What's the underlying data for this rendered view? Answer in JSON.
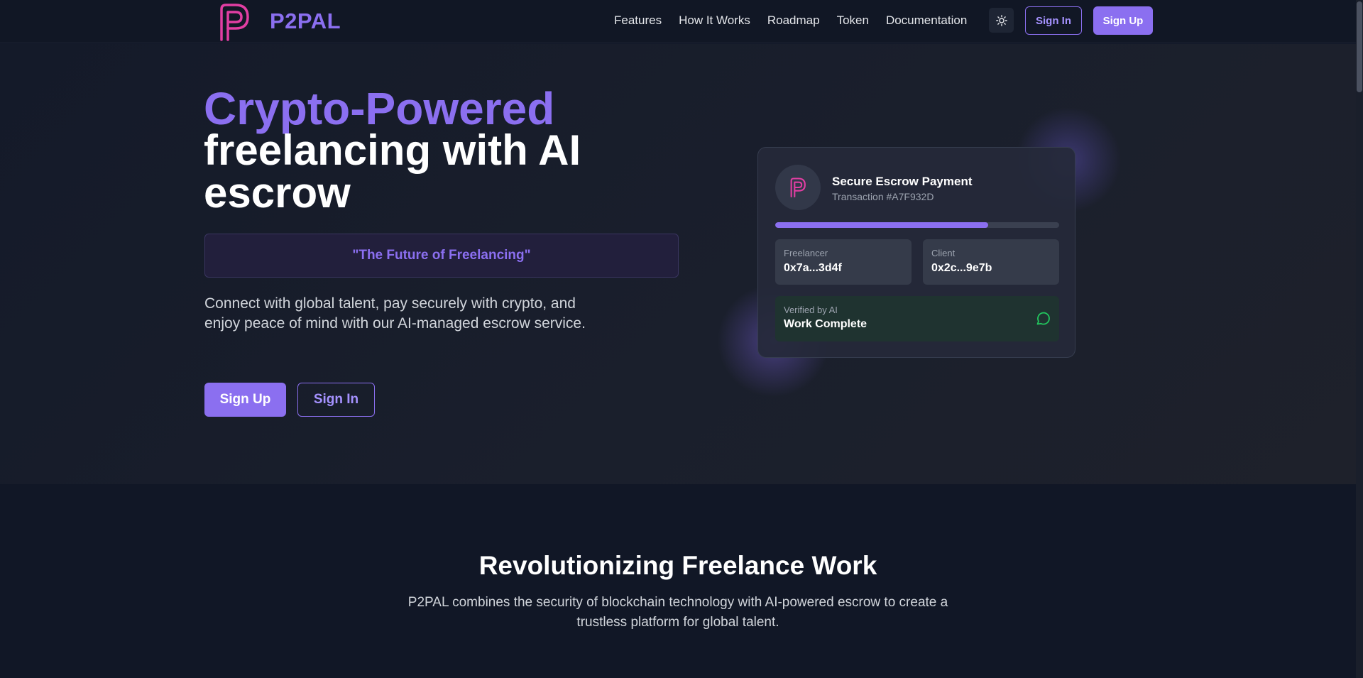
{
  "brand": {
    "name": "P2PAL"
  },
  "nav": {
    "links": [
      "Features",
      "How It Works",
      "Roadmap",
      "Token",
      "Documentation"
    ],
    "sign_in": "Sign In",
    "sign_up": "Sign Up",
    "theme_icon": "sun-icon"
  },
  "hero": {
    "title_accent": "Crypto-Powered",
    "title_line2": "freelancing with AI",
    "title_line3": "escrow",
    "tagline": "\"The Future of Freelancing\"",
    "description": "Connect with global talent, pay securely with crypto, and enjoy peace of mind with our AI-managed escrow service.",
    "sign_up": "Sign Up",
    "sign_in": "Sign In"
  },
  "card": {
    "title": "Secure Escrow Payment",
    "transaction": "Transaction #A7F932D",
    "progress": 0.75,
    "freelancer": {
      "label": "Freelancer",
      "value": "0x7a...3d4f"
    },
    "client": {
      "label": "Client",
      "value": "0x2c...9e7b"
    },
    "verify": {
      "label": "Verified by AI",
      "value": "Work Complete",
      "icon": "chat-bubble-icon"
    }
  },
  "section2": {
    "title": "Revolutionizing Freelance Work",
    "description": "P2PAL combines the security of blockchain technology with AI-powered escrow to create a trustless platform for global talent."
  },
  "colors": {
    "accent": "#8b6ff0",
    "logo_pink": "#e23ea3",
    "success": "#22c55e",
    "background": "#111726"
  }
}
